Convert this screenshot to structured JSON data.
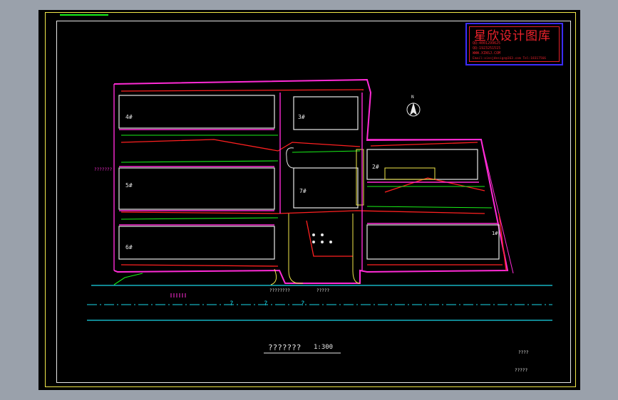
{
  "colors": {
    "background": "#9aa1ab",
    "sheet": "#000000",
    "frame": "#f2e84a",
    "wall_white": "#e8e8e8",
    "magenta": "#ff2bd6",
    "red": "#ff2020",
    "green": "#18f018",
    "yellow": "#f2e84a",
    "cyan": "#19d7e8",
    "stamp_blue": "#3b2cff",
    "stamp_red": "#f0232d"
  },
  "stamp": {
    "brand": "星欣设计图库",
    "line1": "QQ:4001299625",
    "line2": "QQ:1923251515",
    "line3": "WWW.XINSJ.COM",
    "line4": "Email:xinsjdesign@163.com Tel:18317566"
  },
  "plan": {
    "title": "???????",
    "scale": "1:300",
    "road_label_1": "????????",
    "road_label_2": "?????",
    "centerline_marks": [
      "?",
      "?",
      "?"
    ],
    "left_note": "???????",
    "north_label": "N",
    "building_numbers": [
      "1#",
      "2#",
      "3#",
      "4#",
      "5#",
      "6#",
      "7#"
    ],
    "bottom_right_note_1": "????",
    "bottom_right_note_2": "?????"
  }
}
